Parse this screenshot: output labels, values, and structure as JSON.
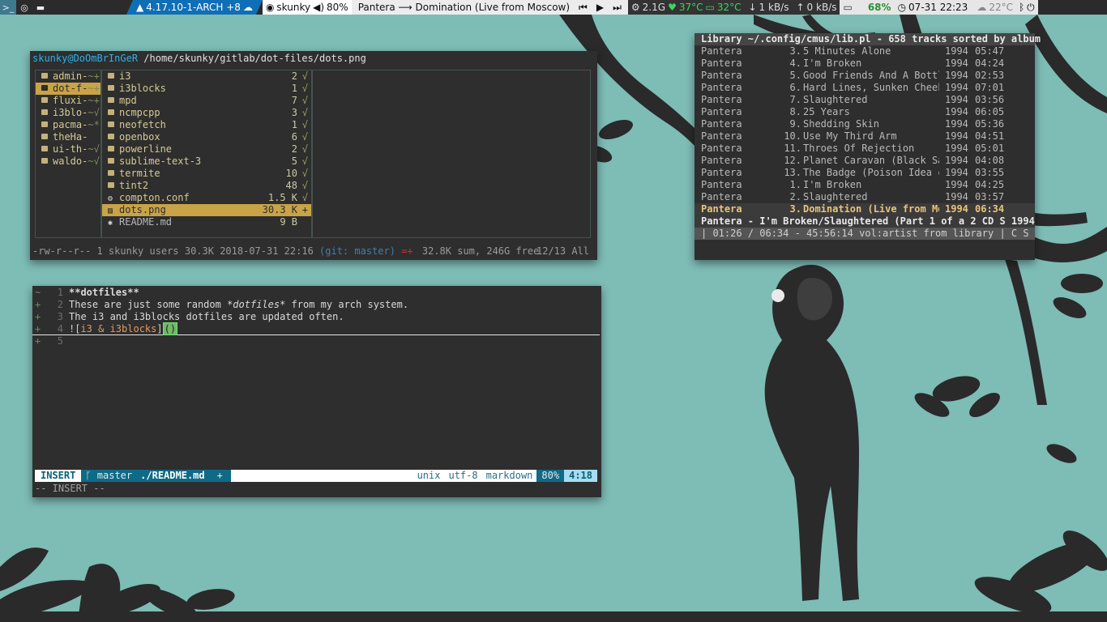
{
  "bar": {
    "kernel": "4.17.10-1-ARCH +8",
    "user": "skunky",
    "volume": "80%",
    "song": "Pantera ⟶ Domination (Live from Moscow)",
    "mem": "2.1G",
    "cpu_temp": "37°C",
    "gpu_temp": "32°C",
    "down": "1 kB/s",
    "up": "0 kB/s",
    "battery": "68%",
    "datetime": "07-31 22:23",
    "weather": "22°C"
  },
  "ranger": {
    "user_host": "skunky@DoOmBrInGeR",
    "path": "/home/skunky/gitlab/dot-files/dots.png",
    "parent": [
      {
        "name": "admin-",
        "flag": "~+",
        "selected": false
      },
      {
        "name": "dot-f-",
        "flag": "~+",
        "selected": true
      },
      {
        "name": "fluxi-",
        "flag": "~+",
        "selected": false
      },
      {
        "name": "i3blo-",
        "flag": "~√",
        "selected": false
      },
      {
        "name": "pacma-",
        "flag": "~*",
        "selected": false
      },
      {
        "name": "theHa-",
        "flag": "",
        "selected": false
      },
      {
        "name": "ui-th-",
        "flag": "~√",
        "selected": false
      },
      {
        "name": "waldo-",
        "flag": "~√",
        "selected": false
      }
    ],
    "files": [
      {
        "name": "i3",
        "size": "2",
        "mark": "√",
        "kind": "dir",
        "selected": false
      },
      {
        "name": "i3blocks",
        "size": "1",
        "mark": "√",
        "kind": "dir",
        "selected": false
      },
      {
        "name": "mpd",
        "size": "7",
        "mark": "√",
        "kind": "dir",
        "selected": false
      },
      {
        "name": "ncmpcpp",
        "size": "3",
        "mark": "√",
        "kind": "dir",
        "selected": false
      },
      {
        "name": "neofetch",
        "size": "1",
        "mark": "√",
        "kind": "dir",
        "selected": false
      },
      {
        "name": "openbox",
        "size": "6",
        "mark": "√",
        "kind": "dir",
        "selected": false
      },
      {
        "name": "powerline",
        "size": "2",
        "mark": "√",
        "kind": "dir",
        "selected": false
      },
      {
        "name": "sublime-text-3",
        "size": "5",
        "mark": "√",
        "kind": "dir",
        "selected": false
      },
      {
        "name": "termite",
        "size": "10",
        "mark": "√",
        "kind": "dir",
        "selected": false
      },
      {
        "name": "tint2",
        "size": "48",
        "mark": "√",
        "kind": "dir",
        "selected": false
      },
      {
        "name": "compton.conf",
        "size": "1.5 K",
        "mark": "√",
        "kind": "conf",
        "selected": false
      },
      {
        "name": "dots.png",
        "size": "30.3 K",
        "mark": "+",
        "kind": "png",
        "selected": true
      },
      {
        "name": "README.md",
        "size": "9 B",
        "mark": "",
        "kind": "md",
        "selected": false
      }
    ],
    "status": {
      "perm": "-rw-r--r--",
      "info": "1 skunky users 30.3K 2018-07-31 22:16",
      "git": "(git: master)",
      "flag": "=+",
      "disk": "32.8K sum, 246G free",
      "pos": "12/13  All"
    }
  },
  "cmus": {
    "header": "Library ~/.config/cmus/lib.pl - 658 tracks sorted by album",
    "tracks": [
      {
        "artist": "Pantera",
        "num": "3.",
        "title": "5 Minutes Alone",
        "year": "1994",
        "dur": "05:47",
        "current": false
      },
      {
        "artist": "Pantera",
        "num": "4.",
        "title": "I'm Broken",
        "year": "1994",
        "dur": "04:24",
        "current": false
      },
      {
        "artist": "Pantera",
        "num": "5.",
        "title": "Good Friends And A Bottl",
        "year": "1994",
        "dur": "02:53",
        "current": false
      },
      {
        "artist": "Pantera",
        "num": "6.",
        "title": "Hard Lines, Sunken Cheek",
        "year": "1994",
        "dur": "07:01",
        "current": false
      },
      {
        "artist": "Pantera",
        "num": "7.",
        "title": "Slaughtered",
        "year": "1994",
        "dur": "03:56",
        "current": false
      },
      {
        "artist": "Pantera",
        "num": "8.",
        "title": "25 Years",
        "year": "1994",
        "dur": "06:05",
        "current": false
      },
      {
        "artist": "Pantera",
        "num": "9.",
        "title": "Shedding Skin",
        "year": "1994",
        "dur": "05:36",
        "current": false
      },
      {
        "artist": "Pantera",
        "num": "10.",
        "title": "Use My Third Arm",
        "year": "1994",
        "dur": "04:51",
        "current": false
      },
      {
        "artist": "Pantera",
        "num": "11.",
        "title": "Throes Of Rejection",
        "year": "1994",
        "dur": "05:01",
        "current": false
      },
      {
        "artist": "Pantera",
        "num": "12.",
        "title": "Planet Caravan (Black Sa",
        "year": "1994",
        "dur": "04:08",
        "current": false
      },
      {
        "artist": "Pantera",
        "num": "13.",
        "title": "The Badge (Poison Idea c",
        "year": "1994",
        "dur": "03:55",
        "current": false
      },
      {
        "artist": "Pantera",
        "num": "1.",
        "title": "I'm Broken",
        "year": "1994",
        "dur": "04:25",
        "current": false
      },
      {
        "artist": "Pantera",
        "num": "2.",
        "title": "Slaughtered",
        "year": "1994",
        "dur": "03:57",
        "current": false
      },
      {
        "artist": "Pantera",
        "num": "3.",
        "title": "Domination (Live from Mo",
        "year": "1994",
        "dur": "06:34",
        "current": true
      }
    ],
    "now_playing": "Pantera - I'm Broken/Slaughtered (Part 1 of a 2 CD S 1994",
    "status": "| 01:26 / 06:34 - 45:56:14 vol:artist from library | C  S"
  },
  "vim": {
    "lines": [
      {
        "gutter": "~",
        "num": "1",
        "parts": [
          {
            "t": "**dotfiles**",
            "c": "b"
          }
        ],
        "cursorline": false
      },
      {
        "gutter": "+",
        "num": "2",
        "parts": [
          {
            "t": "These are just some random ",
            "c": ""
          },
          {
            "t": "*dotfiles*",
            "c": "em"
          },
          {
            "t": " from my arch system.",
            "c": ""
          }
        ],
        "cursorline": false
      },
      {
        "gutter": "+",
        "num": "3",
        "parts": [
          {
            "t": "The i3 and i3blocks dotfiles are updated often.",
            "c": ""
          }
        ],
        "cursorline": false
      },
      {
        "gutter": "+",
        "num": "4",
        "parts": [
          {
            "t": "![",
            "c": "br"
          },
          {
            "t": "i3 & i3blocks",
            "c": "lnk"
          },
          {
            "t": "]",
            "c": "br"
          },
          {
            "t": "()",
            "c": "cursor"
          }
        ],
        "cursorline": true
      },
      {
        "gutter": "+",
        "num": "5",
        "parts": [],
        "cursorline": false
      }
    ],
    "status": {
      "mode": "INSERT",
      "branch": "ᚴ master",
      "file": "./README.md",
      "plus": "+",
      "format": "unix",
      "encoding": "utf-8",
      "filetype": "markdown",
      "percent": "80%",
      "position": "4:18"
    },
    "cmdline": "-- INSERT --"
  }
}
